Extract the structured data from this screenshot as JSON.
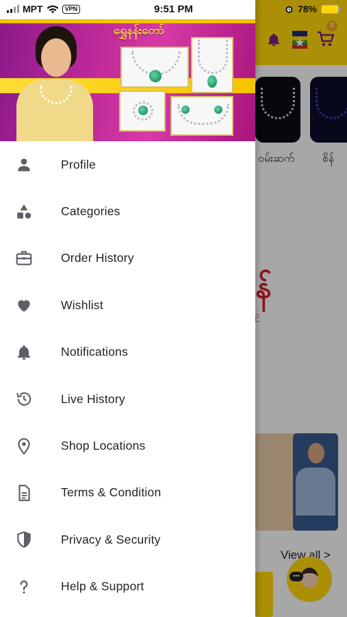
{
  "status_bar": {
    "carrier": "MPT",
    "vpn": "VPN",
    "time": "9:51 PM",
    "battery": "78%"
  },
  "drawer": {
    "banner_title": "ရွှေနန်းတော်",
    "menu": [
      {
        "label": "Profile",
        "icon": "person-icon"
      },
      {
        "label": "Categories",
        "icon": "shapes-icon"
      },
      {
        "label": "Order History",
        "icon": "briefcase-icon"
      },
      {
        "label": "Wishlist",
        "icon": "heart-icon"
      },
      {
        "label": "Notifications",
        "icon": "bell-icon"
      },
      {
        "label": "Live History",
        "icon": "history-icon"
      },
      {
        "label": "Shop Locations",
        "icon": "location-pin-icon"
      },
      {
        "label": "Terms & Condition",
        "icon": "document-icon"
      },
      {
        "label": "Privacy & Security",
        "icon": "shield-icon"
      },
      {
        "label": "Help & Support",
        "icon": "question-icon"
      }
    ]
  },
  "background_app": {
    "cart_count": "0",
    "category_1": "ဝမ်းဆက်",
    "category_2": "စိန်",
    "brand_logo": "န်",
    "brand_sub": "ဥ",
    "view_all": "View all >",
    "assistant_dots": "•••"
  },
  "colors": {
    "brand_purple": "#7a1b8a",
    "brand_yellow": "#ffd60a",
    "icon_grey": "#5e5e66",
    "brand_red": "#d11b2a"
  }
}
